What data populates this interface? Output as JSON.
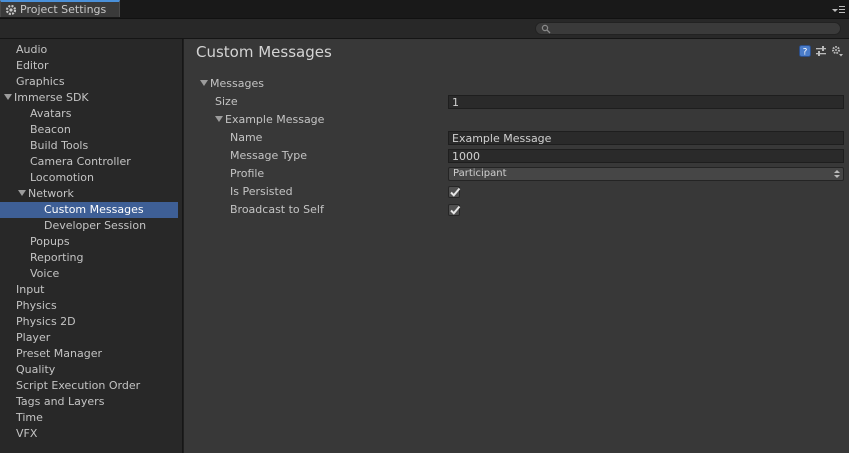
{
  "window": {
    "tab_title": "Project Settings"
  },
  "sidebar": {
    "items": [
      {
        "label": "Audio"
      },
      {
        "label": "Editor"
      },
      {
        "label": "Graphics"
      },
      {
        "label": "Immerse SDK"
      },
      {
        "label": "Avatars"
      },
      {
        "label": "Beacon"
      },
      {
        "label": "Build Tools"
      },
      {
        "label": "Camera Controller"
      },
      {
        "label": "Locomotion"
      },
      {
        "label": "Network"
      },
      {
        "label": "Custom Messages"
      },
      {
        "label": "Developer Session"
      },
      {
        "label": "Popups"
      },
      {
        "label": "Reporting"
      },
      {
        "label": "Voice"
      },
      {
        "label": "Input"
      },
      {
        "label": "Physics"
      },
      {
        "label": "Physics 2D"
      },
      {
        "label": "Player"
      },
      {
        "label": "Preset Manager"
      },
      {
        "label": "Quality"
      },
      {
        "label": "Script Execution Order"
      },
      {
        "label": "Tags and Layers"
      },
      {
        "label": "Time"
      },
      {
        "label": "VFX"
      }
    ]
  },
  "main": {
    "title": "Custom Messages",
    "messages_label": "Messages",
    "size_label": "Size",
    "size_value": "1",
    "element_label": "Example Message",
    "name_label": "Name",
    "name_value": "Example Message",
    "type_label": "Message Type",
    "type_value": "1000",
    "profile_label": "Profile",
    "profile_value": "Participant",
    "persisted_label": "Is Persisted",
    "persisted_checked": true,
    "broadcast_label": "Broadcast to Self",
    "broadcast_checked": true
  },
  "colors": {
    "selection": "#3e5f96",
    "panel": "#383838",
    "sidebar": "#282828",
    "help_icon": "#4a7cc9"
  }
}
